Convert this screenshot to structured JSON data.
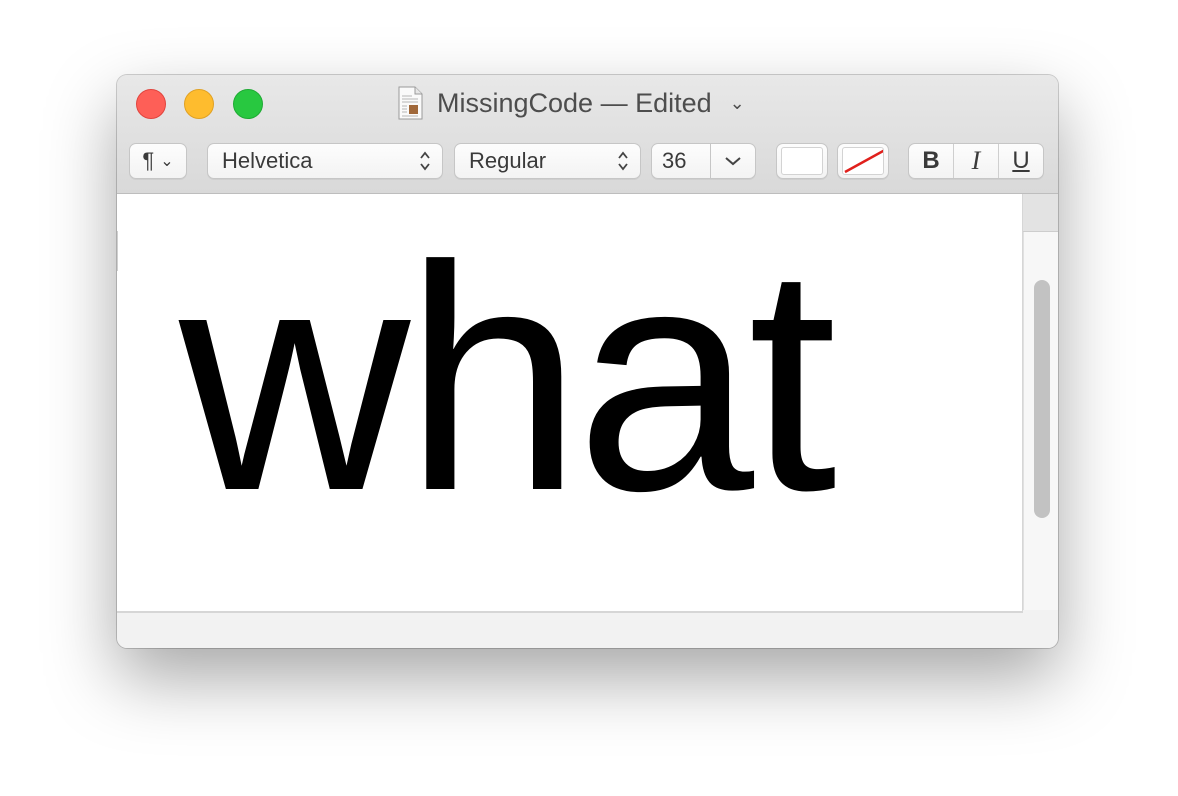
{
  "window": {
    "title": "MissingCode — Edited",
    "title_chevron": "⌄"
  },
  "toolbar": {
    "paragraph_icon": "¶",
    "paragraph_chevron": "⌄",
    "font_family": "Helvetica",
    "font_style": "Regular",
    "font_size": "36",
    "size_chevron": "⌄",
    "bold_label": "B",
    "italic_label": "I",
    "underline_label": "U",
    "text_color": "#ffffff",
    "background_color_slash": "#e0201c"
  },
  "document": {
    "text": "what"
  },
  "colors": {
    "close": "#fe5f57",
    "minimize": "#febc2e",
    "zoom": "#28c840"
  }
}
